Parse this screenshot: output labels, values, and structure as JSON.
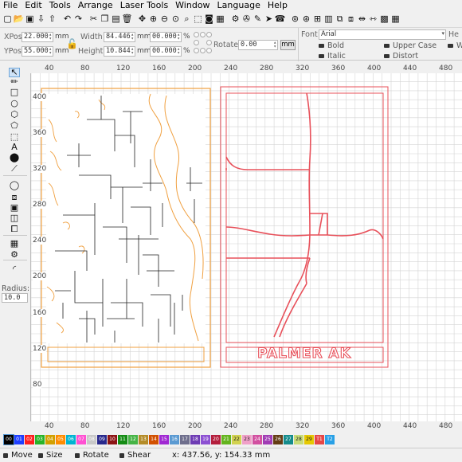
{
  "menu": [
    "File",
    "Edit",
    "Tools",
    "Arrange",
    "Laser Tools",
    "Window",
    "Language",
    "Help"
  ],
  "toolbar_icons": [
    {
      "name": "new-file-icon",
      "glyph": "▢"
    },
    {
      "name": "open-file-icon",
      "glyph": "📂"
    },
    {
      "name": "save-icon",
      "glyph": "▣"
    },
    {
      "name": "import-icon",
      "glyph": "⇩"
    },
    {
      "name": "export-icon",
      "glyph": "⇧"
    },
    {
      "name": "undo-icon",
      "glyph": "↶"
    },
    {
      "name": "redo-icon",
      "glyph": "↷"
    },
    {
      "name": "cut-icon",
      "glyph": "✂"
    },
    {
      "name": "copy-icon",
      "glyph": "❐"
    },
    {
      "name": "paste-icon",
      "glyph": "▤"
    },
    {
      "name": "delete-icon",
      "glyph": "🗑"
    },
    {
      "name": "move-tool-icon",
      "glyph": "✥"
    },
    {
      "name": "zoom-in-icon",
      "glyph": "⊕"
    },
    {
      "name": "zoom-out-icon",
      "glyph": "⊖"
    },
    {
      "name": "zoom-fit-icon",
      "glyph": "⊙"
    },
    {
      "name": "zoom-window-icon",
      "glyph": "⌕"
    },
    {
      "name": "frame-icon",
      "glyph": "⬚"
    },
    {
      "name": "camera-icon",
      "glyph": "◙"
    },
    {
      "name": "trace-image-icon",
      "glyph": "▦"
    },
    {
      "name": "settings-icon",
      "glyph": "⚙"
    },
    {
      "name": "machine-settings-icon",
      "glyph": "✇"
    },
    {
      "name": "tool-wrench-icon",
      "glyph": "✎"
    },
    {
      "name": "send-icon",
      "glyph": "➤"
    },
    {
      "name": "notification-icon",
      "glyph": "☎"
    },
    {
      "name": "target-icon",
      "glyph": "⊚"
    },
    {
      "name": "center-icon",
      "glyph": "⊛"
    },
    {
      "name": "align-icon",
      "glyph": "⊞"
    },
    {
      "name": "distribute-icon",
      "glyph": "▥"
    },
    {
      "name": "group-icon",
      "glyph": "⧉"
    },
    {
      "name": "ungroup-icon",
      "glyph": "⧈"
    },
    {
      "name": "flip-icon",
      "glyph": "⇹"
    },
    {
      "name": "mirror-icon",
      "glyph": "⇿"
    },
    {
      "name": "arrange-icon",
      "glyph": "▩"
    },
    {
      "name": "grid-icon",
      "glyph": "▦"
    }
  ],
  "props": {
    "xpos_label": "XPos",
    "xpos_value": "22.000",
    "ypos_label": "YPos",
    "ypos_value": "55.000",
    "mm": "mm",
    "width_label": "Width",
    "width_value": "84.446",
    "height_label": "Height",
    "height_value": "10.844",
    "scale_w": "00.000",
    "scale_h": "00.000",
    "percent": "%",
    "rotate_label": "Rotate",
    "rotate_value": "0.00",
    "mm_button": "mm",
    "font_label": "Font",
    "font_value": "Arial",
    "he_label": "He",
    "bold": "Bold",
    "italic": "Italic",
    "upper": "Upper Case",
    "distort": "Distort",
    "we_label": "We"
  },
  "left_tools": [
    {
      "name": "select-arrow-icon",
      "glyph": "↖",
      "selected": true
    },
    {
      "name": "pen-draw-icon",
      "glyph": "✏"
    },
    {
      "name": "rectangle-icon",
      "glyph": "□"
    },
    {
      "name": "ellipse-icon",
      "glyph": "○"
    },
    {
      "name": "polygon-icon",
      "glyph": "⬡"
    },
    {
      "name": "edit-nodes-icon",
      "glyph": "⬠"
    },
    {
      "name": "text-box-icon",
      "glyph": "⬚"
    },
    {
      "name": "text-icon",
      "glyph": "A"
    },
    {
      "name": "position-pin-icon",
      "glyph": "⬤"
    },
    {
      "name": "measure-icon",
      "glyph": "⟋"
    },
    {
      "name": "offset-icon",
      "glyph": "◯"
    },
    {
      "name": "weld-icon",
      "glyph": "⧈"
    },
    {
      "name": "boolean-union-icon",
      "glyph": "▣"
    },
    {
      "name": "boolean-subtract-icon",
      "glyph": "◫"
    },
    {
      "name": "boolean-intersect-icon",
      "glyph": "⧠"
    },
    {
      "name": "array-grid-icon",
      "glyph": "▦"
    },
    {
      "name": "circular-array-icon",
      "glyph": "⚙"
    },
    {
      "name": "rounded-corner-icon",
      "glyph": "◜"
    }
  ],
  "radius": {
    "label": "Radius:",
    "value": "10.0"
  },
  "rulers": {
    "top": [
      "40",
      "80",
      "120",
      "160",
      "200",
      "240",
      "280",
      "320",
      "360",
      "400",
      "440",
      "480"
    ],
    "bottom": [
      "40",
      "80",
      "120",
      "160",
      "200",
      "240",
      "280",
      "320",
      "360",
      "400",
      "440",
      "480"
    ],
    "left": [
      "400",
      "360",
      "320",
      "280",
      "240",
      "200",
      "160",
      "120",
      "80"
    ]
  },
  "canvas": {
    "label_text": "PALMER AK",
    "colors": {
      "orange": "#f0a040",
      "red": "#e8505a",
      "grid": "#d4d4d4"
    }
  },
  "palette": [
    {
      "label": "00",
      "color": "#000000"
    },
    {
      "label": "01",
      "color": "#1f3fff"
    },
    {
      "label": "02",
      "color": "#ff1f1f"
    },
    {
      "label": "03",
      "color": "#28b428"
    },
    {
      "label": "04",
      "color": "#d2a000"
    },
    {
      "label": "05",
      "color": "#ff8c00"
    },
    {
      "label": "06",
      "color": "#00b4d2"
    },
    {
      "label": "07",
      "color": "#ff50d2"
    },
    {
      "label": "08",
      "color": "#c8c8c8"
    },
    {
      "label": "09",
      "color": "#28288c"
    },
    {
      "label": "10",
      "color": "#8c1414"
    },
    {
      "label": "11",
      "color": "#148c14"
    },
    {
      "label": "12",
      "color": "#46b446"
    },
    {
      "label": "13",
      "color": "#b48c28"
    },
    {
      "label": "14",
      "color": "#d25000"
    },
    {
      "label": "15",
      "color": "#a028d2"
    },
    {
      "label": "16",
      "color": "#5a9ad2"
    },
    {
      "label": "17",
      "color": "#6e6e8c"
    },
    {
      "label": "18",
      "color": "#6e3cb4"
    },
    {
      "label": "19",
      "color": "#8c50d2"
    },
    {
      "label": "20",
      "color": "#b41e3c"
    },
    {
      "label": "21",
      "color": "#64b41e"
    },
    {
      "label": "22",
      "color": "#d2d250"
    },
    {
      "label": "23",
      "color": "#f0a0c8"
    },
    {
      "label": "24",
      "color": "#d250a0"
    },
    {
      "label": "25",
      "color": "#a03cb4"
    },
    {
      "label": "26",
      "color": "#643c14"
    },
    {
      "label": "27",
      "color": "#148c8c"
    },
    {
      "label": "28",
      "color": "#c8dc78"
    },
    {
      "label": "29",
      "color": "#e6c800"
    },
    {
      "label": "T1",
      "color": "#e64646"
    },
    {
      "label": "T2",
      "color": "#28a0e6"
    }
  ],
  "status": {
    "move": "Move",
    "size": "Size",
    "rotate": "Rotate",
    "shear": "Shear",
    "coords": "x: 437.56, y: 154.33 mm"
  }
}
